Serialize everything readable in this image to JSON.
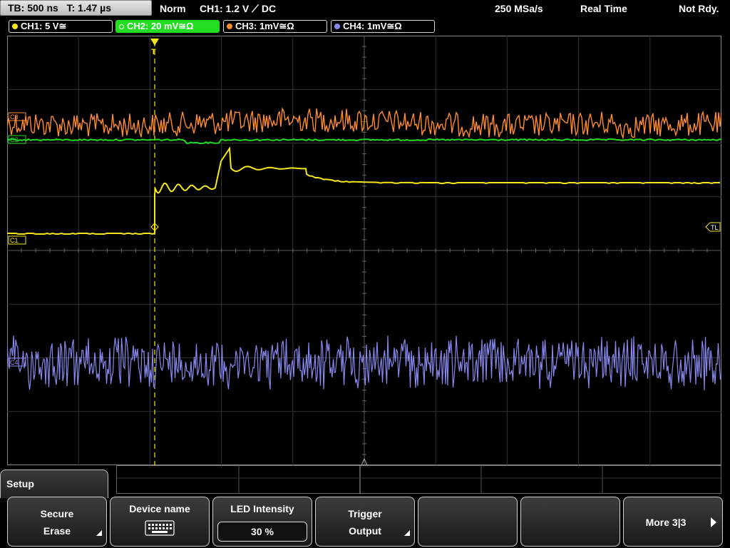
{
  "status_bar": {
    "timebase": "TB: 500 ns",
    "trigger_time": "T: 1.47 µs",
    "mode": "Norm",
    "trigger_info": "CH1: 1.2 V ⟋ DC",
    "sample_rate": "250 MSa/s",
    "acq_mode": "Real Time",
    "state": "Not Rdy."
  },
  "channels": [
    {
      "label": "CH1: 5 V≅",
      "color": "#f5e61c",
      "active": false
    },
    {
      "label": "CH2: 20 mV≅Ω",
      "color": "#22dd22",
      "active": true
    },
    {
      "label": "CH3: 1mV≅Ω",
      "color": "#ff8c2a",
      "active": false
    },
    {
      "label": "CH4: 1mV≅Ω",
      "color": "#8888ee",
      "active": false
    }
  ],
  "markers": {
    "ch1_label": "C1",
    "ch2_label": "C2",
    "ch3_label": "C3",
    "ch4_label": "C4",
    "trigger_level": "TL",
    "trigger_pos": "T"
  },
  "menu": {
    "title": "Setup",
    "softkeys": {
      "secure_erase_1": "Secure",
      "secure_erase_2": "Erase",
      "device_name": "Device name",
      "led_label": "LED Intensity",
      "led_value": "30 %",
      "trigger_output_1": "Trigger",
      "trigger_output_2": "Output",
      "more": "More 3|3"
    }
  },
  "icons": {
    "keyboard": "keyboard-icon",
    "submenu": "submenu-corner-icon",
    "next": "arrow-right-icon"
  }
}
